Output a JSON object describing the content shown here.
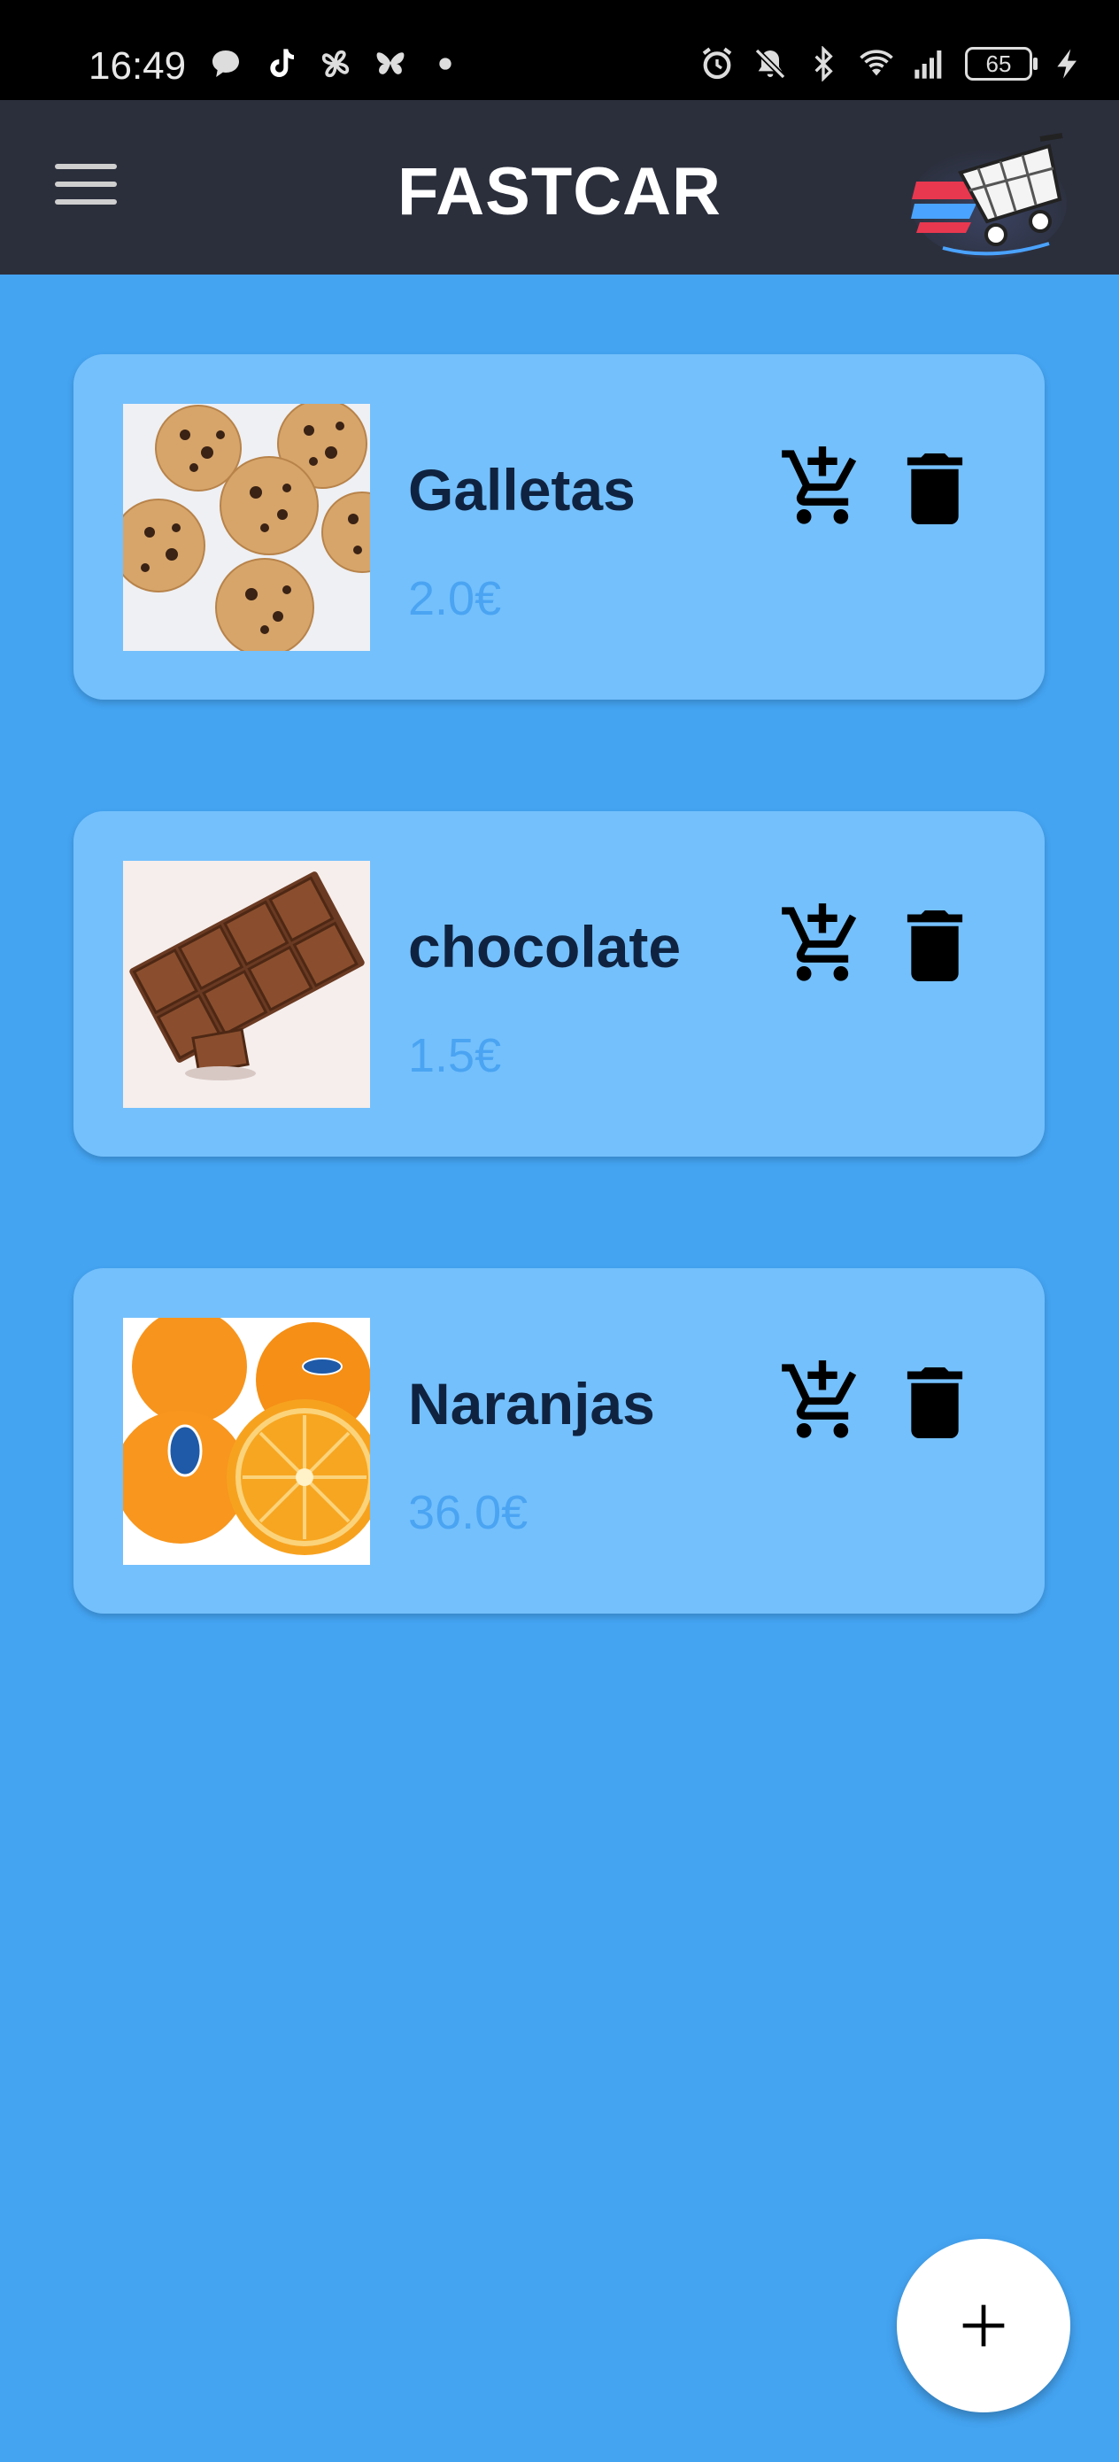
{
  "status_bar": {
    "time": "16:49",
    "battery": "65",
    "left_icons": [
      "chat-bubble-icon",
      "tiktok-icon",
      "pinwheel-icon",
      "butterfly-icon",
      "dot-icon"
    ],
    "right_icons": [
      "alarm-icon",
      "mute-icon",
      "bluetooth-icon",
      "wifi-icon",
      "signal-icon",
      "battery-icon",
      "charging-icon"
    ]
  },
  "app_bar": {
    "title": "FASTCAR",
    "menu_icon": "hamburger-menu-icon",
    "logo": "shopping-cart-logo"
  },
  "products": [
    {
      "name": "Galletas",
      "price": "2.0€",
      "image": "cookies-image"
    },
    {
      "name": "chocolate",
      "price": "1.5€",
      "image": "chocolate-image"
    },
    {
      "name": "Naranjas",
      "price": "36.0€",
      "image": "oranges-image"
    }
  ],
  "actions": {
    "add_to_cart_icon": "add-shopping-cart-icon",
    "delete_icon": "trash-icon"
  },
  "fab": {
    "icon": "plus-icon"
  },
  "colors": {
    "background": "#44a4f2",
    "card": "#74c0fc",
    "app_bar": "#2b2f3c",
    "price": "#4aa4f2",
    "name": "#0f2340"
  }
}
